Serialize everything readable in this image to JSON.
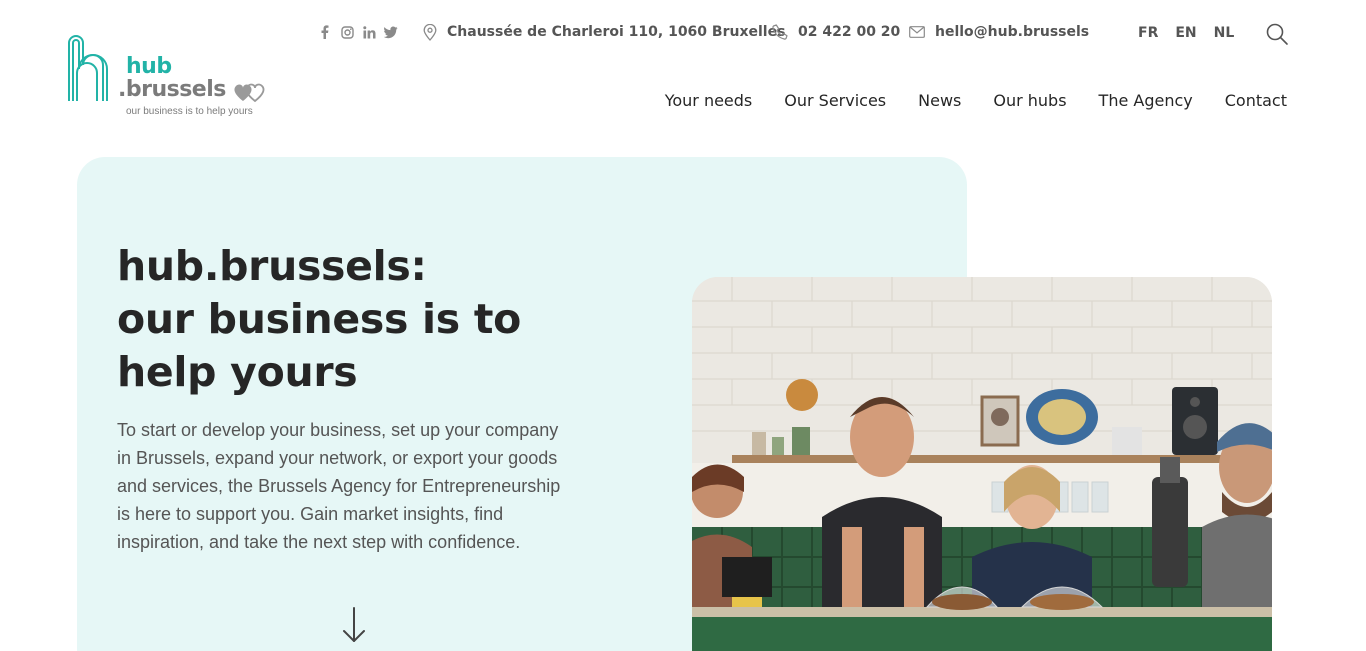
{
  "header": {
    "logo": {
      "word1": "hub",
      "word2": ".brussels",
      "tagline": "our business is to help yours",
      "brand_color": "#22b3a7",
      "grey": "#7b7b7b"
    },
    "social": [
      {
        "name": "facebook-icon",
        "glyph": "f"
      },
      {
        "name": "instagram-icon",
        "glyph": "◎"
      },
      {
        "name": "linkedin-icon",
        "glyph": "in"
      },
      {
        "name": "twitter-icon",
        "glyph": "🐦"
      }
    ],
    "address": "Chaussée de Charleroi 110, 1060 Bruxelles",
    "phone": "02 422 00 20",
    "email": "hello@hub.brussels",
    "languages": [
      "FR",
      "EN",
      "NL"
    ],
    "search_icon": "search-icon"
  },
  "nav": {
    "items": [
      "Your needs",
      "Our Services",
      "News",
      "Our hubs",
      "The Agency",
      "Contact"
    ]
  },
  "hero": {
    "title_lines": [
      "hub.brussels:",
      "our business is to",
      "help yours"
    ],
    "text": "To start or develop your business, set up your company in Brussels, expand your network, or export your goods and services, the Brussels Agency for Entrepreneurship is here to support you. Gain market insights, find inspiration, and take the next step with confidence.",
    "card_color": "#e6f7f6",
    "scroll_icon": "arrow-down-icon",
    "photo_alt": "photo of people laughing behind a café counter"
  }
}
